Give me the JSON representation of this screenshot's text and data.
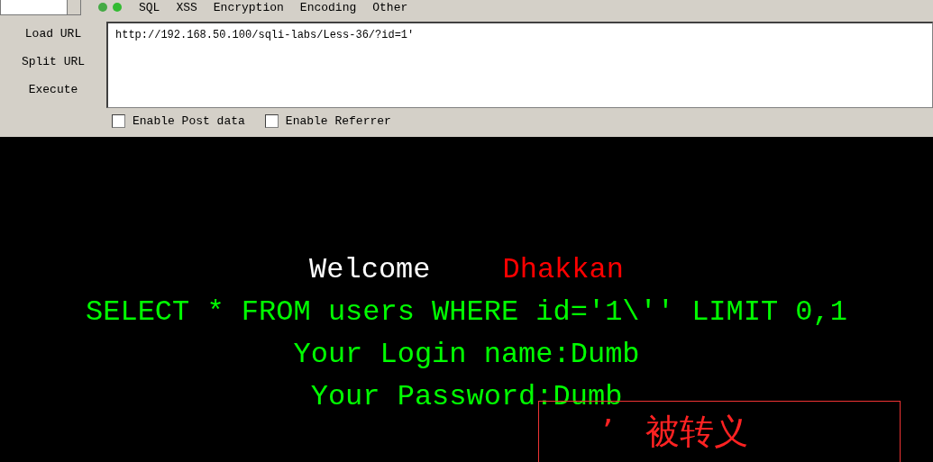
{
  "toolbar": {
    "menus": [
      "SQL",
      "XSS",
      "Encryption",
      "Encoding",
      "Other"
    ]
  },
  "actions": [
    "Load URL",
    "Split URL",
    "Execute"
  ],
  "url_field": {
    "value": "http://192.168.50.100/sqli-labs/Less-36/?id=1'"
  },
  "options": [
    {
      "label": "Enable Post data",
      "checked": false
    },
    {
      "label": "Enable Referrer",
      "checked": false
    }
  ],
  "page": {
    "welcome": "Welcome",
    "name": "Dhakkan",
    "query": "SELECT * FROM users WHERE id='1\\'' LIMIT 0,1",
    "login": "Your Login name:Dumb",
    "password": "Your Password:Dumb"
  },
  "annotation": {
    "text": "’   被转义"
  }
}
